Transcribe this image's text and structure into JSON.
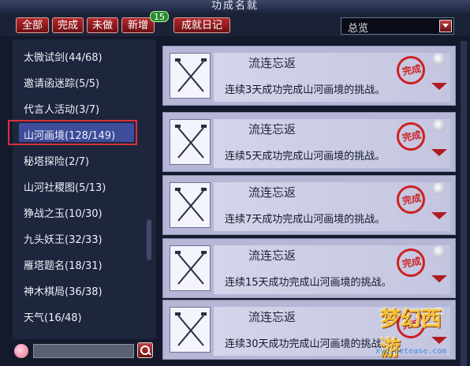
{
  "window": {
    "title": "功成名就"
  },
  "tabs": [
    {
      "label": "全部"
    },
    {
      "label": "完成"
    },
    {
      "label": "未做"
    },
    {
      "label": "新增",
      "badge": "15"
    },
    {
      "label": "成就日记"
    }
  ],
  "filter": {
    "value": "总览"
  },
  "sidebar": {
    "items": [
      {
        "label": "太微试剑(44/68)"
      },
      {
        "label": "邀请函迷踪(5/5)"
      },
      {
        "label": "代言人活动(3/7)"
      },
      {
        "label": "山河画境(128/149)",
        "selected": true
      },
      {
        "label": "秘塔探险(2/7)"
      },
      {
        "label": "山河社稷图(5/13)"
      },
      {
        "label": "狰战之玉(10/30)"
      },
      {
        "label": "九头妖王(32/33)"
      },
      {
        "label": "雁塔题名(18/31)"
      },
      {
        "label": "神木棋局(36/38)"
      },
      {
        "label": "天气(16/48)"
      }
    ]
  },
  "search": {
    "placeholder": ""
  },
  "achievements": [
    {
      "title": "流连忘返",
      "desc": "连续3天成功完成山河画境的挑战。",
      "seal": "完成"
    },
    {
      "title": "流连忘返",
      "desc": "连续5天成功完成山河画境的挑战。",
      "seal": "完成"
    },
    {
      "title": "流连忘返",
      "desc": "连续7天成功完成山河画境的挑战。",
      "seal": "完成"
    },
    {
      "title": "流连忘返",
      "desc": "连续15天成功完成山河画境的挑战。",
      "seal": "完成"
    },
    {
      "title": "流连忘返",
      "desc": "连续30天成功完成山河画境的挑战。",
      "seal": "完成"
    }
  ],
  "watermark": {
    "logo": "梦幻西游",
    "url": "xyq.netease.com"
  },
  "colors": {
    "accent": "#b3292c",
    "selection": "#3e4c9c",
    "card": "#b6b7d6",
    "seal": "#cc2222"
  }
}
